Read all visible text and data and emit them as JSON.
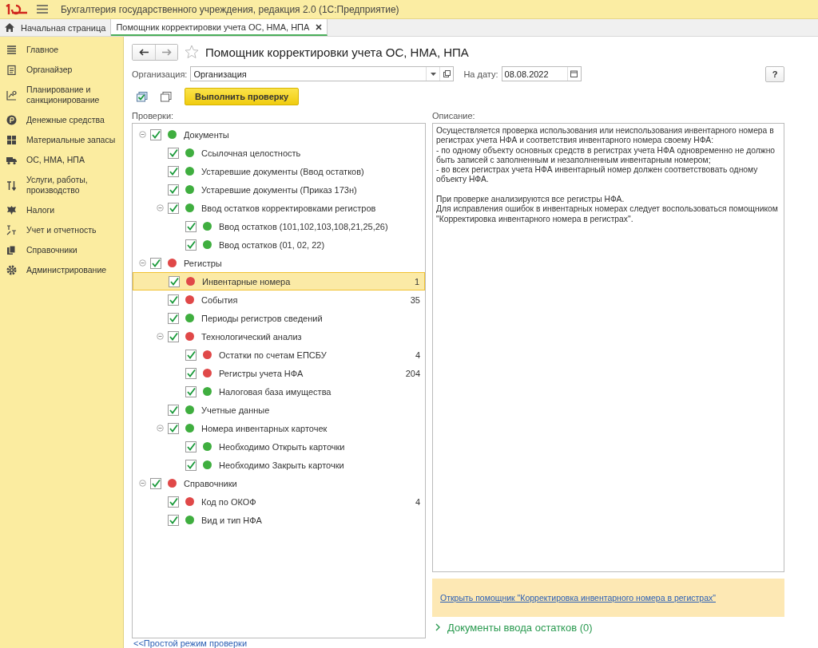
{
  "window": {
    "title": "Бухгалтерия государственного учреждения, редакция 2.0  (1С:Предприятие)"
  },
  "tabs": [
    {
      "label": "Начальная страница",
      "kind": "home",
      "selected": false
    },
    {
      "label": "Помощник корректировки учета ОС, НМА, НПА",
      "kind": "doc",
      "selected": true
    }
  ],
  "sidebar": {
    "items": [
      {
        "label": "Главное"
      },
      {
        "label": "Органайзер"
      },
      {
        "label": "Планирование и санкционирование"
      },
      {
        "label": "Денежные средства"
      },
      {
        "label": "Материальные запасы"
      },
      {
        "label": "ОС, НМА, НПА"
      },
      {
        "label": "Услуги, работы, производство"
      },
      {
        "label": "Налоги"
      },
      {
        "label": "Учет и отчетность"
      },
      {
        "label": "Справочники"
      },
      {
        "label": "Администрирование"
      }
    ]
  },
  "form": {
    "title": "Помощник корректировки учета ОС, НМА, НПА",
    "organization": {
      "label": "Организация:",
      "value": "Организация"
    },
    "date": {
      "label": "На дату:",
      "value": "08.08.2022"
    },
    "help_button": "?",
    "run_button": "Выполнить проверку",
    "checks_label": "Проверки:",
    "description_label": "Описание:",
    "description": "Осуществляется проверка использования или неиспользования инвентарного номера в регистрах учета НФА и соответствия инвентарного номера своему НФА:\n- по одному объекту основных средств в регистрах учета НФА одновременно не должно быть записей с заполненным и незаполненным инвентарным номером;\n - во всех регистрах учета НФА инвентарный номер должен соответствовать одному объекту НФА.\n\nПри проверке анализируются все регистры НФА.\nДля исправления ошибок в инвентарных номерах следует воспользоваться помощником \"Корректировка инвентарного номера в регистрах\".",
    "assistant_link": "Открыть помощник \"Корректировка инвентарного номера в регистрах\"",
    "balances_section": {
      "label": "Документы ввода остатков (0)",
      "expanded": false
    },
    "simple_mode_link": "<<Простой режим проверки"
  },
  "tree": [
    {
      "label": "Документы",
      "color": "#3fae3f",
      "checked": true,
      "expanded": true,
      "selected": false,
      "children": [
        {
          "label": "Ссылочная целостность",
          "color": "#3fae3f",
          "checked": true,
          "selected": false
        },
        {
          "label": "Устаревшие документы (Ввод остатков)",
          "color": "#3fae3f",
          "checked": true,
          "selected": false
        },
        {
          "label": "Устаревшие документы (Приказ 173н)",
          "color": "#3fae3f",
          "checked": true,
          "selected": false
        },
        {
          "label": "Ввод остатков корректировками регистров",
          "color": "#3fae3f",
          "checked": true,
          "expanded": true,
          "selected": false,
          "children": [
            {
              "label": "Ввод остатков (101,102,103,108,21,25,26)",
              "color": "#3fae3f",
              "checked": true,
              "selected": false
            },
            {
              "label": "Ввод остатков (01, 02, 22)",
              "color": "#3fae3f",
              "checked": true,
              "selected": false
            }
          ]
        }
      ]
    },
    {
      "label": "Регистры",
      "color": "#e04848",
      "checked": true,
      "expanded": true,
      "selected": false,
      "children": [
        {
          "label": "Инвентарные номера",
          "color": "#e04848",
          "checked": true,
          "selected": true,
          "count": "1"
        },
        {
          "label": "События",
          "color": "#e04848",
          "checked": true,
          "selected": false,
          "count": "35"
        },
        {
          "label": "Периоды регистров сведений",
          "color": "#3fae3f",
          "checked": true,
          "selected": false
        },
        {
          "label": "Технологический анализ",
          "color": "#e04848",
          "checked": true,
          "expanded": true,
          "selected": false,
          "children": [
            {
              "label": "Остатки по счетам ЕПСБУ",
              "color": "#e04848",
              "checked": true,
              "selected": false,
              "count": "4"
            },
            {
              "label": "Регистры учета НФА",
              "color": "#e04848",
              "checked": true,
              "selected": false,
              "count": "204"
            },
            {
              "label": "Налоговая база имущества",
              "color": "#3fae3f",
              "checked": true,
              "selected": false
            }
          ]
        },
        {
          "label": "Учетные данные",
          "color": "#3fae3f",
          "checked": true,
          "selected": false
        },
        {
          "label": "Номера инвентарных карточек",
          "color": "#3fae3f",
          "checked": true,
          "expanded": true,
          "selected": false,
          "children": [
            {
              "label": "Необходимо Открыть карточки",
              "color": "#3fae3f",
              "checked": true,
              "selected": false
            },
            {
              "label": "Необходимо Закрыть карточки",
              "color": "#3fae3f",
              "checked": true,
              "selected": false
            }
          ]
        }
      ]
    },
    {
      "label": "Справочники",
      "color": "#e04848",
      "checked": true,
      "expanded": true,
      "selected": false,
      "children": [
        {
          "label": "Код по ОКОФ",
          "color": "#e04848",
          "checked": true,
          "selected": false,
          "count": "4"
        },
        {
          "label": "Вид и тип НФА",
          "color": "#3fae3f",
          "checked": true,
          "selected": false
        }
      ]
    }
  ]
}
